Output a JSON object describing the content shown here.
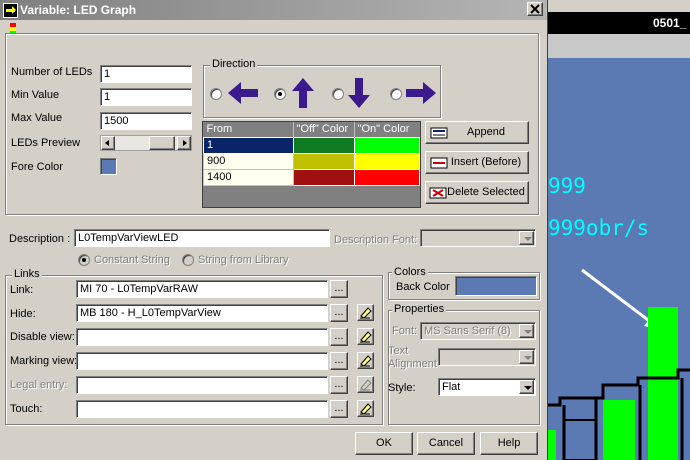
{
  "title": "Variable: LED Graph",
  "background_app": {
    "header": "0501_",
    "readout1": "999",
    "readout2": "999obr/s"
  },
  "general": {
    "number_of_leds_label": "Number of LEDs",
    "number_of_leds_value": "1",
    "min_value_label": "Min Value",
    "min_value_value": "1",
    "max_value_label": "Max Value",
    "max_value_value": "1500",
    "leds_preview_label": "LEDs Preview",
    "fore_color_label": "Fore Color"
  },
  "direction": {
    "label": "Direction",
    "options": [
      "left",
      "up",
      "down",
      "right"
    ],
    "selected": "up"
  },
  "led_table": {
    "headers": [
      "From",
      "\"Off\" Color",
      "\"On\" Color"
    ],
    "rows": [
      {
        "from": "1",
        "off_color": "#0e7a22",
        "on_color": "#00ff00"
      },
      {
        "from": "900",
        "off_color": "#c0c000",
        "on_color": "#ffff00"
      },
      {
        "from": "1400",
        "off_color": "#a01010",
        "on_color": "#ff0000"
      }
    ]
  },
  "table_buttons": {
    "append": "Append",
    "insert": "Insert (Before)",
    "delete": "Delete Selected"
  },
  "description": {
    "label": "Description :",
    "value": "L0TempVarViewLED",
    "font_label": "Description Font:",
    "constant_string": "Constant String",
    "string_from_library": "String from Library"
  },
  "links": {
    "label": "Links",
    "rows": [
      {
        "label": "Link:",
        "value": "MI 70  - L0TempVarRAW"
      },
      {
        "label": "Hide:",
        "value": "MB 180  - H_L0TempVarView"
      },
      {
        "label": "Disable view:",
        "value": ""
      },
      {
        "label": "Marking view:",
        "value": ""
      },
      {
        "label": "Legal entry:",
        "value": ""
      },
      {
        "label": "Touch:",
        "value": ""
      }
    ],
    "browse_label": "..."
  },
  "colors": {
    "label": "Colors",
    "back_color_label": "Back Color",
    "back_color": "#5b79b3"
  },
  "properties": {
    "label": "Properties",
    "font_label": "Font:",
    "font_value": "MS Sans Serif (8)",
    "text_alignment_label": "Text Alignment",
    "style_label": "Style:",
    "style_value": "Flat"
  },
  "buttons": {
    "ok": "OK",
    "cancel": "Cancel",
    "help": "Help"
  },
  "colors_theme": {
    "arrow": "#3a1a8c",
    "selection": "#0a246a",
    "led_green": "#00ff00"
  }
}
